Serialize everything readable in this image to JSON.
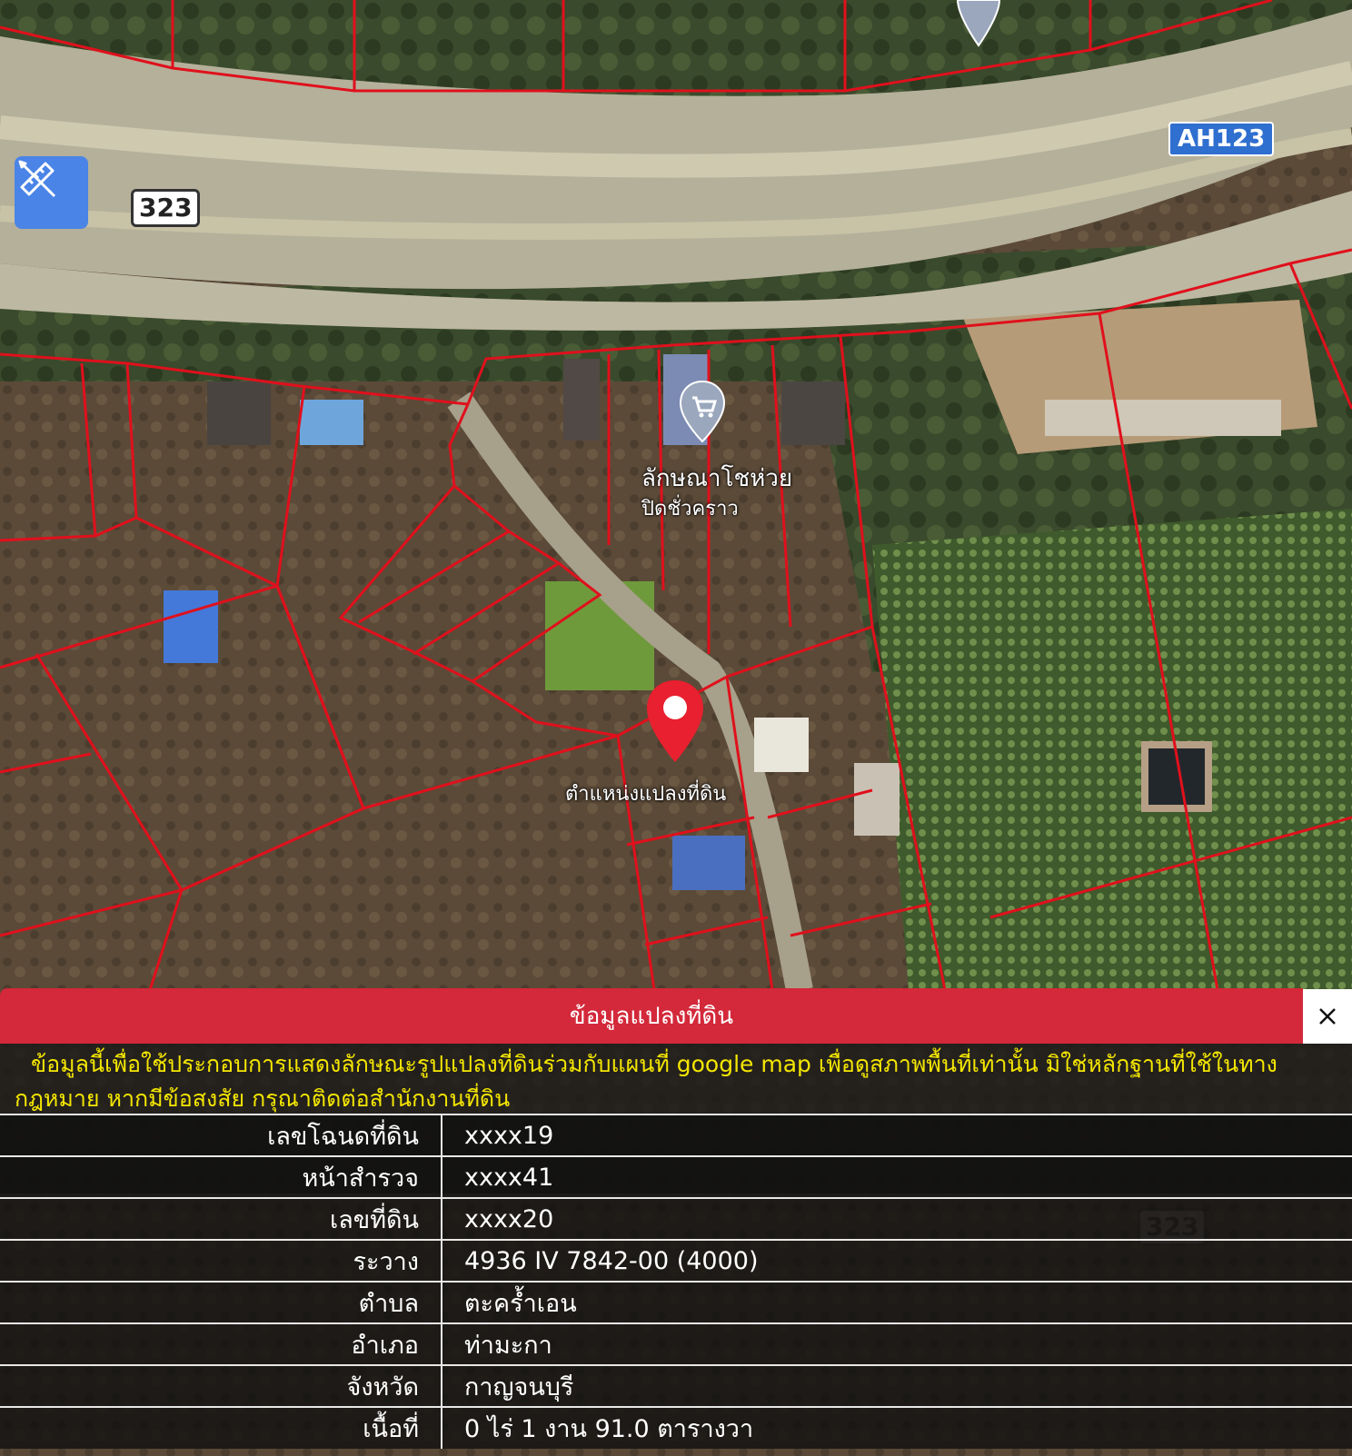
{
  "map": {
    "road_shields": [
      "323",
      "AH123",
      "323"
    ],
    "place_labels": [
      "ลักษณาโชห่วย",
      "ปิดชั่วคราว"
    ],
    "marker_label": "ตำแหน่งแปลงที่ดิน",
    "marker_color": "#e8202f",
    "parcel_line_color": "#e0101c",
    "icons": [
      "measure-tool-icon",
      "shop-pin-icon",
      "location-pin-icon",
      "place-pin-icon"
    ]
  },
  "panel": {
    "title": "ข้อมูลแปลงที่ดิน",
    "close_label": "×",
    "header_color": "#d3293a",
    "disclaimer": "ข้อมูลนี้เพื่อใช้ประกอบการแสดงลักษณะรูปแปลงที่ดินร่วมกับแผนที่ google map เพื่อดูสภาพพื้นที่เท่านั้น มิใช่หลักฐานที่ใช้ในทางกฎหมาย หากมีข้อสงสัย กรุณาติดต่อสำนักงานที่ดิน",
    "disclaimer_color": "#f4e600",
    "rows": [
      {
        "label": "เลขโฉนดที่ดิน",
        "value": "xxxx19"
      },
      {
        "label": "หน้าสำรวจ",
        "value": "xxxx41"
      },
      {
        "label": "เลขที่ดิน",
        "value": "xxxx20"
      },
      {
        "label": "ระวาง",
        "value": "4936 IV 7842-00 (4000)"
      },
      {
        "label": "ตำบล",
        "value": "ตะคร้ำเอน"
      },
      {
        "label": "อำเภอ",
        "value": "ท่ามะกา"
      },
      {
        "label": "จังหวัด",
        "value": "กาญจนบุรี"
      },
      {
        "label": "เนื้อที่",
        "value": "0 ไร่ 1 งาน 91.0 ตารางวา"
      }
    ]
  }
}
